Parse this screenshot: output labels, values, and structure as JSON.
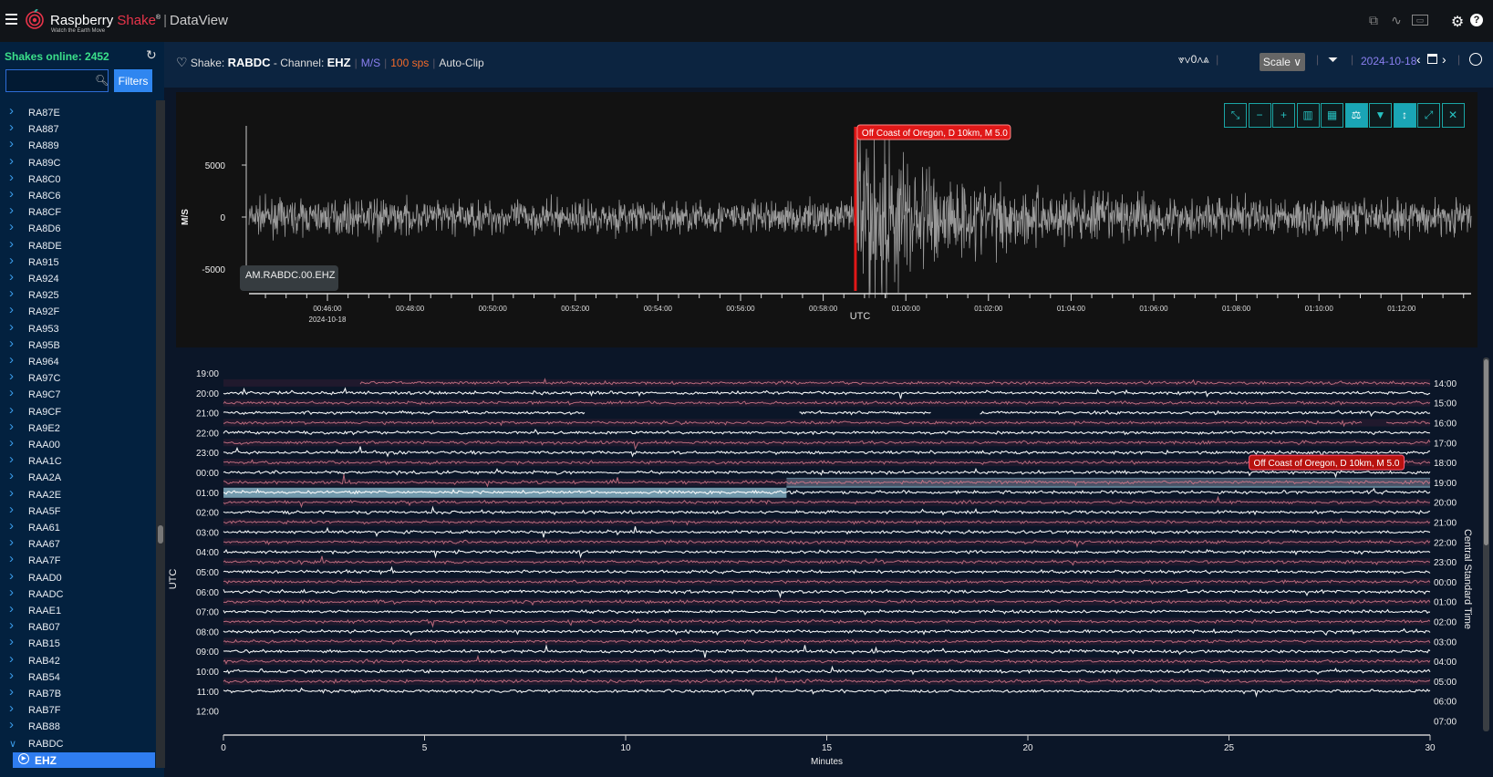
{
  "app": {
    "brand_main": "Raspberry",
    "brand_accent": "Shake",
    "reg": "®",
    "brand_product": "DataView",
    "tagline": "Watch the Earth Move"
  },
  "topbar_icons": [
    "compare-icon",
    "spectrogram-icon",
    "live-icon",
    "gear-icon",
    "help-icon"
  ],
  "sidebar": {
    "online_label": "Shakes online: 2452",
    "search": {
      "value": "",
      "placeholder": ""
    },
    "filters_label": "Filters",
    "items": [
      "RA87E",
      "RA887",
      "RA889",
      "RA89C",
      "RA8C0",
      "RA8C6",
      "RA8CF",
      "RA8D6",
      "RA8DE",
      "RA915",
      "RA924",
      "RA925",
      "RA92F",
      "RA953",
      "RA95B",
      "RA964",
      "RA97C",
      "RA9C7",
      "RA9CF",
      "RA9E2",
      "RAA00",
      "RAA1C",
      "RAA2A",
      "RAA2E",
      "RAA5F",
      "RAA61",
      "RAA67",
      "RAA7F",
      "RAAD0",
      "RAADC",
      "RAAE1",
      "RAB07",
      "RAB15",
      "RAB42",
      "RAB54",
      "RAB7B",
      "RAB7F",
      "RAB88",
      "RABDC"
    ],
    "expanded_item": "RABDC",
    "selected_channel": "EHZ"
  },
  "header": {
    "shake_label": "Shake:",
    "shake": "RABDC",
    "channel_label": "- Channel:",
    "channel": "EHZ",
    "units": "M/S",
    "sps": "100 sps",
    "clip": "Auto-Clip"
  },
  "controls": {
    "offset_value": "0",
    "scale_label": "Scale",
    "date": "2024-10-18"
  },
  "toolbar": [
    "collapse",
    "zoom-out",
    "zoom-in",
    "spectrum",
    "grid",
    "balance",
    "filter",
    "vertical-scale",
    "expand",
    "close"
  ],
  "waveform": {
    "ylabel": "M/S",
    "xlabel": "UTC",
    "station_label": "AM.RABDC.00.EHZ",
    "y_ticks": [
      "5000",
      "0",
      "-5000"
    ],
    "x_ticks": [
      "00:46:00",
      "00:48:00",
      "00:50:00",
      "00:52:00",
      "00:54:00",
      "00:56:00",
      "00:58:00",
      "01:00:00",
      "01:02:00",
      "01:04:00",
      "01:06:00",
      "01:08:00",
      "01:10:00",
      "01:12:00"
    ],
    "x_date": "2024-10-18",
    "event_label": "Off Coast of Oregon, D 10km, M 5.0"
  },
  "helicorder": {
    "left_label": "UTC",
    "right_label": "Central Standard Time",
    "xlabel": "Minutes",
    "left_ticks": [
      "19:00",
      "20:00",
      "21:00",
      "22:00",
      "23:00",
      "00:00",
      "01:00",
      "02:00",
      "03:00",
      "04:00",
      "05:00",
      "06:00",
      "07:00",
      "08:00",
      "09:00",
      "10:00",
      "11:00",
      "12:00"
    ],
    "right_ticks": [
      "14:00",
      "15:00",
      "16:00",
      "17:00",
      "18:00",
      "19:00",
      "20:00",
      "21:00",
      "22:00",
      "23:00",
      "00:00",
      "01:00",
      "02:00",
      "03:00",
      "04:00",
      "05:00",
      "06:00",
      "07:00"
    ],
    "x_ticks": [
      "0",
      "5",
      "10",
      "15",
      "20",
      "25",
      "30"
    ],
    "event_label": "Off Coast of Oregon, D 10km, M 5.0"
  },
  "chart_data": [
    {
      "type": "line",
      "title": "",
      "ylabel": "M/S",
      "xlabel": "UTC",
      "ylim": [
        -8000,
        8000
      ],
      "x_range": [
        "2024-10-18 00:44:06",
        "2024-10-18 01:13:42"
      ],
      "event": {
        "time": "2024-10-18 00:58:47",
        "label": "Off Coast of Oregon, D 10km, M 5.0"
      }
    },
    {
      "type": "line",
      "title": "",
      "xlabel": "Minutes",
      "xlim": [
        0,
        30
      ],
      "ylabel": "UTC",
      "event": {
        "time": "00:58:47",
        "label": "Off Coast of Oregon, D 10km, M 5.0"
      }
    }
  ],
  "colors": {
    "accent": "#2f86f0",
    "online": "#3be08a",
    "units": "#8a7ff0",
    "sps": "#f26a2a",
    "event": "#e01818",
    "tool": "#1aa5a5",
    "trace_white": "#ffffff",
    "trace_pink": "#e07d8f",
    "highlight": "#9fd3e6"
  }
}
